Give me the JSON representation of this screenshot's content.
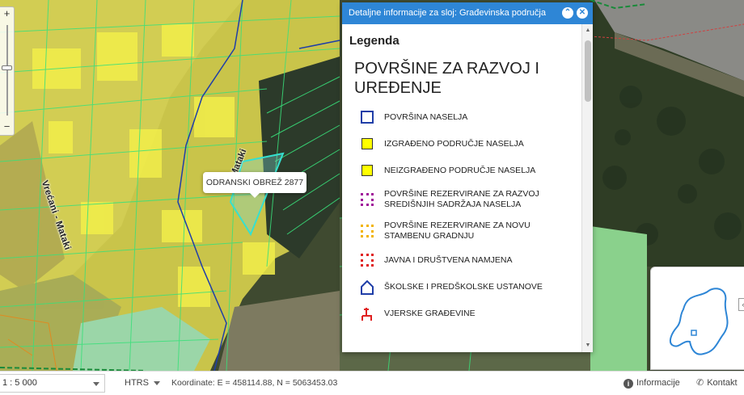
{
  "panel": {
    "title": "Detaljne informacije za sloj: Građevinska područja",
    "collapse_icon": "chevron-up-icon",
    "close_icon": "close-icon",
    "legend_heading": "Legenda",
    "section_title": "POVRŠINE ZA RAZVOJ I UREĐENJE",
    "items": [
      {
        "label": "POVRŠINA NASELJA",
        "symbol": "outline-square",
        "color": "#1f3ea8"
      },
      {
        "label": "IZGRAĐENO PODRUČJE NASELJA",
        "symbol": "filled-square",
        "color": "#ffff00"
      },
      {
        "label": "NEIZGRAĐENO PODRUČJE NASELJA",
        "symbol": "filled-square",
        "color": "#ffff00"
      },
      {
        "label": "POVRŠINE REZERVIRANE ZA RAZVOJ SREDIŠNJIH SADRŽAJA NASELJA",
        "symbol": "dotted-square",
        "color": "#a0169a"
      },
      {
        "label": "POVRŠINE REZERVIRANE ZA NOVU STAMBENU GRADNJU",
        "symbol": "dotted-square",
        "color": "#f2b400"
      },
      {
        "label": "JAVNA I DRUŠTVENA NAMJENA",
        "symbol": "dotted-square",
        "color": "#e02020"
      },
      {
        "label": "ŠKOLSKE I PREDŠKOLSKE USTANOVE",
        "symbol": "house-outline-icon",
        "color": "#1f3ea8"
      },
      {
        "label": "VJERSKE GRAĐEVINE",
        "symbol": "cross-icon",
        "color": "#e02020"
      }
    ]
  },
  "map": {
    "popup_label": "ODRANSKI OBREŽ 2877",
    "road_label": "Vrećani - Mataki",
    "road_label_2": "Mataki"
  },
  "zoom": {
    "in_label": "+",
    "out_label": "−"
  },
  "statusbar": {
    "scale": "1 : 5 000",
    "crs": "HTRS",
    "coordinates": "Koordinate: E = 458114.88, N = 5063453.03",
    "info_label": "Informacije",
    "contact_label": "Kontakt"
  },
  "overview": {
    "toggle_label": "‹"
  }
}
